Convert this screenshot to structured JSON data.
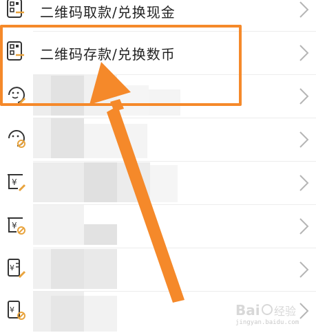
{
  "menu": {
    "items": [
      {
        "label": "二维码取款/兑换现金",
        "icon": "qr-code-icon"
      },
      {
        "label": "二维码存款/兑换数币",
        "icon": "qr-code-icon"
      },
      {
        "label": "",
        "icon": "face-edit-icon"
      },
      {
        "label": "",
        "icon": "face-disabled-icon"
      },
      {
        "label": "",
        "icon": "yuan-card-edit-icon"
      },
      {
        "label": "",
        "icon": "yuan-card-disabled-icon"
      },
      {
        "label": "",
        "icon": "yuan-doc-edit-icon"
      },
      {
        "label": "",
        "icon": "yuan-doc-disabled-icon"
      }
    ]
  },
  "colors": {
    "highlight": "#f5892a",
    "arrow": "#f5892a",
    "icon_accent": "#e8a33d",
    "icon_stroke": "#333333"
  },
  "watermark": {
    "brand": "Baidu",
    "site": "jingyan.baidu.com"
  }
}
